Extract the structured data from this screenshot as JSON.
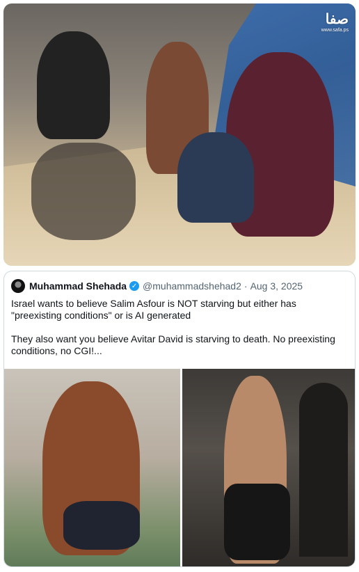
{
  "top_photo": {
    "watermark": {
      "logo_text": "صفا",
      "url_text": "www.safa.ps"
    }
  },
  "tweet": {
    "author_name": "Muhammad Shehada",
    "verified": true,
    "handle": "@muhammadshehad2",
    "separator": "·",
    "date": "Aug 3, 2025",
    "text_paragraph_1": "Israel wants to believe Salim Asfour is NOT starving but either has \"preexisting conditions\" or is AI generated",
    "text_paragraph_2": "They also want you believe Avitar David is starving to death. No preexisting conditions, no CGI!...",
    "media": [
      "media-left-photo",
      "media-right-photo"
    ]
  },
  "colors": {
    "verified_blue": "#1d9bf0",
    "text_primary": "#0f1419",
    "text_secondary": "#536471",
    "border": "#cfd9de"
  }
}
